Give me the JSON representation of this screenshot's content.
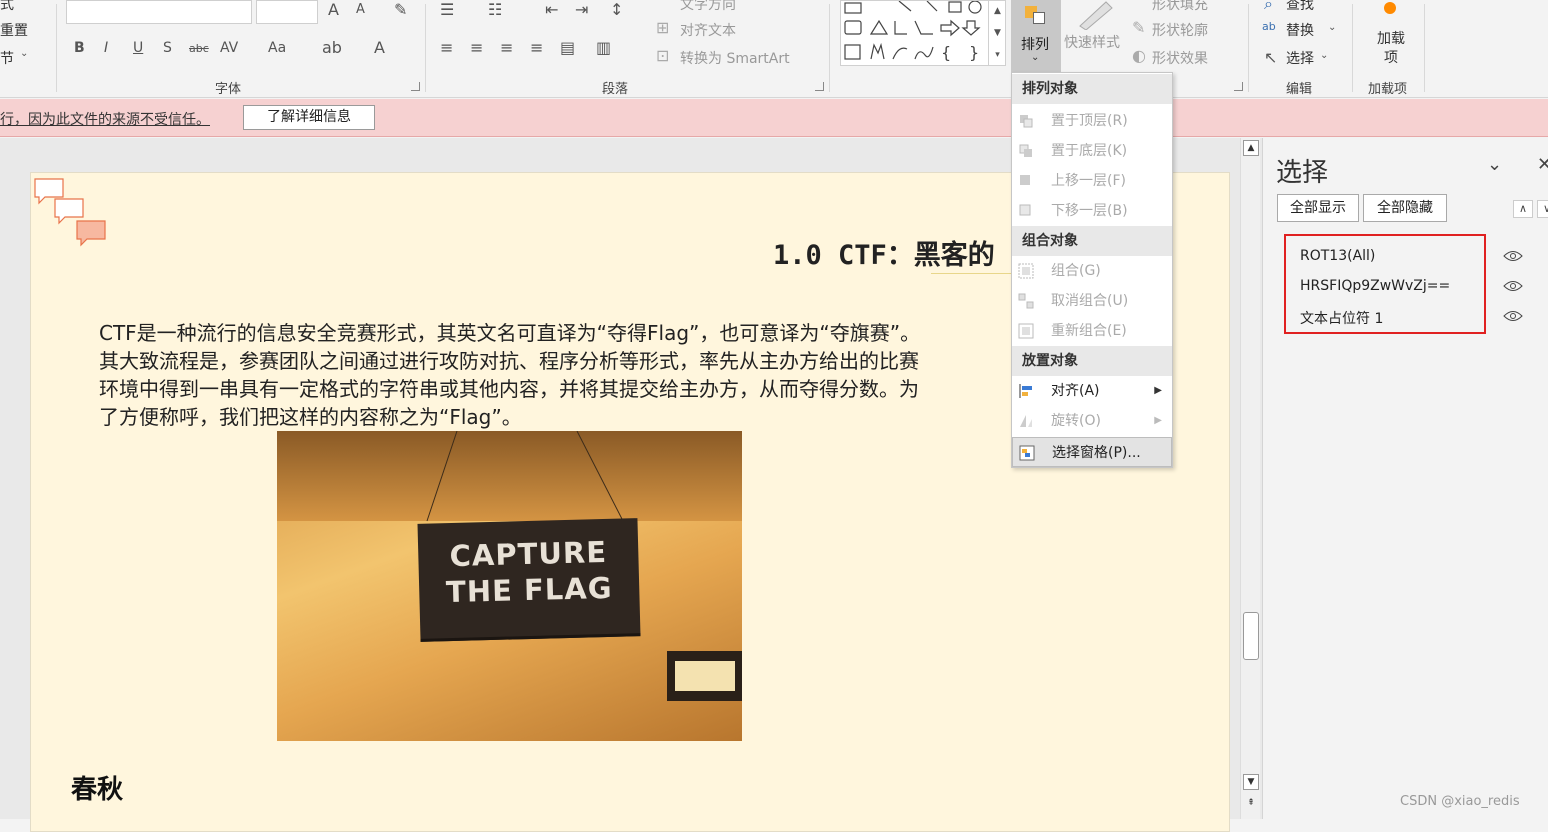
{
  "ribbon": {
    "left_stub_items": [
      "式",
      "重置",
      "节"
    ],
    "font_group_label": "字体",
    "paragraph_group_label": "段落",
    "text_direction_label": "文字方向",
    "align_text_label": "对齐文本",
    "convert_smartart_label": "转换为 SmartArt",
    "arrange_button_label": "排列",
    "quick_styles_label": "快速样式",
    "shape_fill_label": "形状填充",
    "shape_outline_label": "形状轮廓",
    "shape_effects_label": "形状效果",
    "find_label": "查找",
    "replace_label": "替换",
    "select_label": "选择",
    "editing_group_label": "编辑",
    "addins_button_label": "加载项",
    "addins_group_label": "加载项",
    "format_buttons": [
      "B",
      "I",
      "U",
      "S",
      "abc",
      "AV",
      "Aa",
      "A"
    ]
  },
  "warning_bar": {
    "message": "行，因为此文件的来源不受信任。",
    "learn_more_label": "了解详细信息"
  },
  "slide": {
    "title": "1.0  CTF：黑客的",
    "body_lines": [
      "    CTF是一种流行的信息安全竞赛形式，其英文名可直译为“夺得Flag”，也可意译为“夺旗赛”。",
      "其大致流程是，参赛团队之间通过进行攻防对抗、程序分析等形式，率先从主办方给出的比赛",
      "环境中得到一串具有一定格式的字符串或其他内容，并将其提交给主办方，从而夺得分数。为",
      "了方便称呼，我们把这样的内容称之为“Flag”。"
    ],
    "image_sign_line1": "CAPTURE",
    "image_sign_line2": "THE FLAG",
    "logo_text": "春秋"
  },
  "arrange_menu": {
    "sections": [
      {
        "header": "排列对象",
        "items": [
          {
            "label": "置于顶层(R)",
            "enabled": false
          },
          {
            "label": "置于底层(K)",
            "enabled": false
          },
          {
            "label": "上移一层(F)",
            "enabled": false
          },
          {
            "label": "下移一层(B)",
            "enabled": false
          }
        ]
      },
      {
        "header": "组合对象",
        "items": [
          {
            "label": "组合(G)",
            "enabled": false
          },
          {
            "label": "取消组合(U)",
            "enabled": false
          },
          {
            "label": "重新组合(E)",
            "enabled": false
          }
        ]
      },
      {
        "header": "放置对象",
        "items": [
          {
            "label": "对齐(A)",
            "enabled": true
          },
          {
            "label": "旋转(O)",
            "enabled": false
          },
          {
            "label": "选择窗格(P)...",
            "enabled": true
          }
        ]
      }
    ]
  },
  "selection_pane": {
    "title": "选择",
    "show_all_label": "全部显示",
    "hide_all_label": "全部隐藏",
    "objects": [
      "ROT13(All)",
      "HRSFIQp9ZwWvZj==",
      "文本占位符 1"
    ]
  },
  "watermark": "CSDN @xiao_redis",
  "colors": {
    "warning_bg": "#f6d1d1",
    "page_bg": "#fff6dd",
    "highlight_border": "#e02020",
    "addin_dot": "#ff8a00"
  }
}
